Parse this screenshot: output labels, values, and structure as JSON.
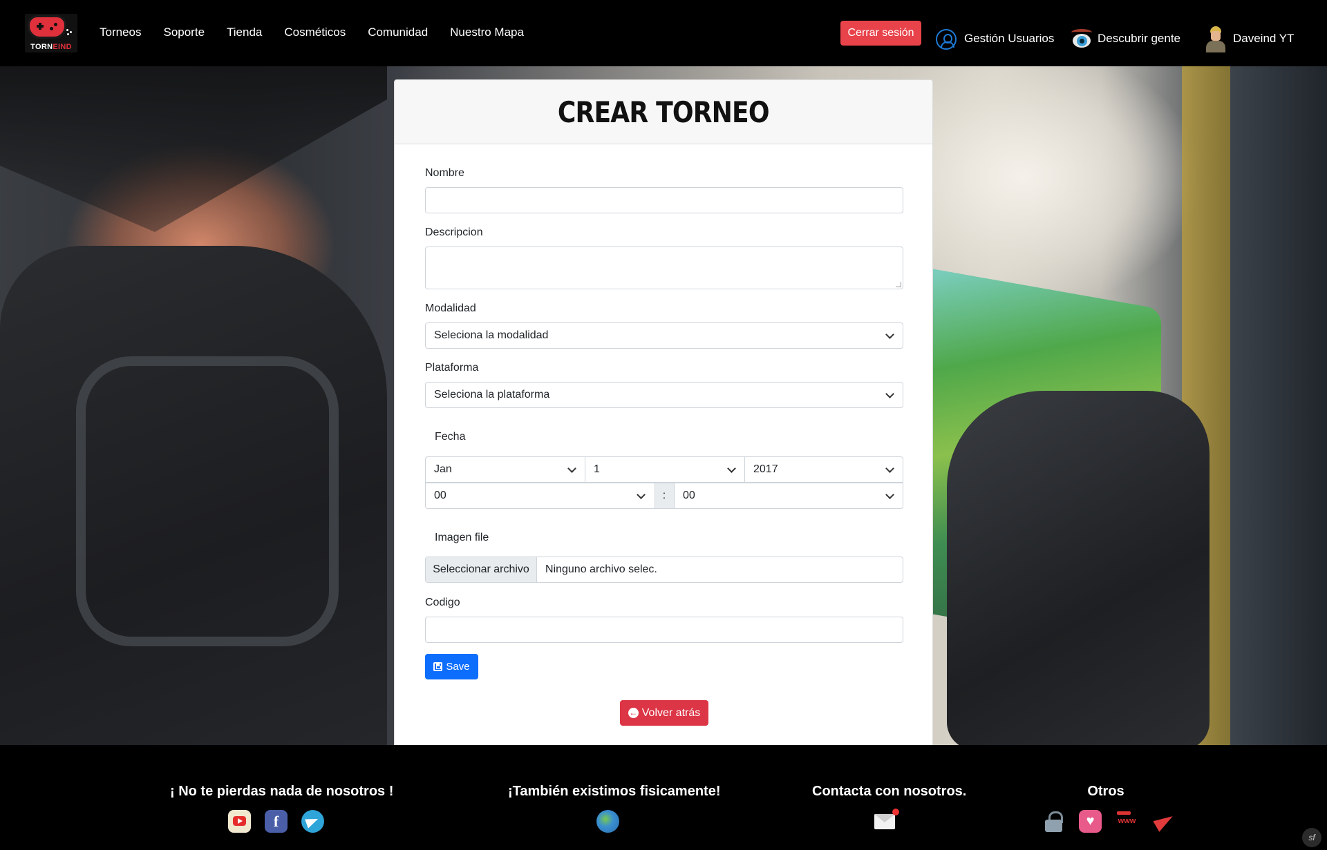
{
  "brand": {
    "logo_text_white": "TORN",
    "logo_text_red": "EIND"
  },
  "nav": {
    "links": [
      "Torneos",
      "Soporte",
      "Tienda",
      "Cosméticos",
      "Comunidad",
      "Nuestro Mapa"
    ],
    "logout_label": "Cerrar sesión",
    "users_label": "Gestión Usuarios",
    "discover_label": "Descubrir gente",
    "user_name": "Daveind YT"
  },
  "form": {
    "title": "CREAR TORNEO",
    "nombre_label": "Nombre",
    "nombre_value": "",
    "descripcion_label": "Descripcion",
    "descripcion_value": "",
    "modalidad_label": "Modalidad",
    "modalidad_value": "Seleciona la modalidad",
    "plataforma_label": "Plataforma",
    "plataforma_value": "Seleciona la plataforma",
    "fecha_label": "Fecha",
    "fecha_month": "Jan",
    "fecha_day": "1",
    "fecha_year": "2017",
    "fecha_hour": "00",
    "fecha_sep": ":",
    "fecha_minute": "00",
    "imagen_label": "Imagen file",
    "file_button": "Seleccionar archivo",
    "file_name": "Ninguno archivo selec.",
    "codigo_label": "Codigo",
    "codigo_value": "",
    "save_label": "Save",
    "back_label": "Volver atrás"
  },
  "footer": {
    "col1_title": "¡ No te pierdas nada de nosotros !",
    "col2_title": "¡También existimos fisicamente!",
    "col3_title": "Contacta con nosotros.",
    "col4_title": "Otros",
    "icons": [
      "youtube-icon",
      "facebook-icon",
      "telegram-icon",
      "globe-icon",
      "mail-icon",
      "lock-icon",
      "heart-icon",
      "www-icon",
      "send-icon"
    ]
  },
  "colors": {
    "accent": "#0d6efd",
    "danger": "#dc3545",
    "logout": "#e8434b",
    "navbar": "#000000"
  }
}
